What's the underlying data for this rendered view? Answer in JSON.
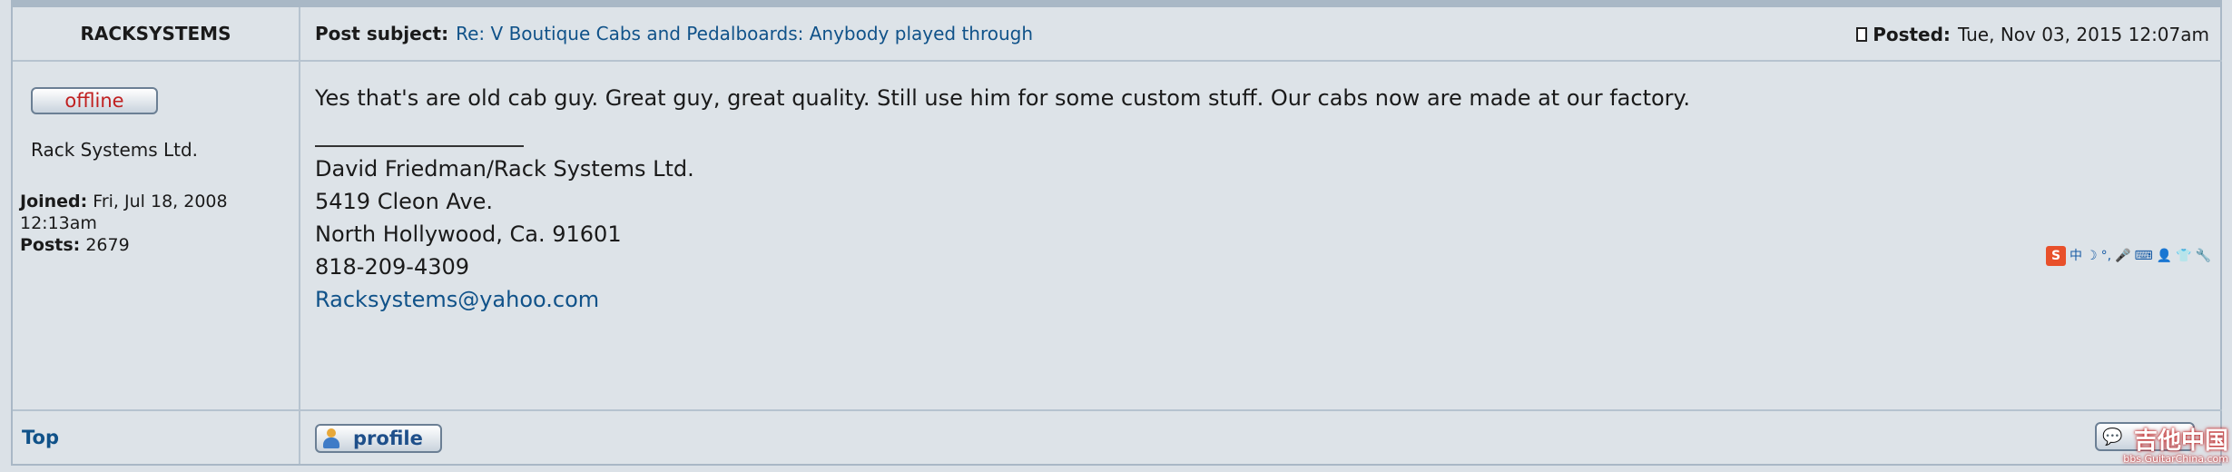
{
  "post": {
    "author": "RACKSYSTEMS",
    "subject_label": "Post subject:",
    "subject": "Re: V Boutique Cabs and Pedalboards: Anybody played through",
    "posted_label": "Posted:",
    "posted_value": "Tue, Nov 03, 2015 12:07am",
    "status_button": "offline",
    "rank": "Rack Systems Ltd.",
    "joined_label": "Joined:",
    "joined_value": "Fri, Jul 18, 2008 12:13am",
    "posts_label": "Posts:",
    "posts_value": "2679",
    "message": "Yes that's are old cab guy. Great guy, great quality. Still use him for some custom stuff. Our cabs now are made at our factory.",
    "signature": {
      "rule": "________________",
      "line1": "David Friedman/Rack Systems Ltd.",
      "line2": "5419 Cleon Ave.",
      "line3": "North Hollywood, Ca. 91601",
      "line4": "818-209-4309",
      "email": "Racksystems@yahoo.com"
    },
    "top_link": "Top",
    "profile_button": "profile"
  },
  "ime_bar": {
    "logo": "S",
    "glyphs": [
      "中",
      "☽",
      "°,",
      "🎤",
      "⌨",
      "👤",
      "👕",
      "🔧"
    ]
  },
  "watermark": {
    "title": "吉他中国",
    "url": "bbs.GuitarChina.com"
  },
  "colors": {
    "link": "#105289",
    "offline": "#c02020",
    "border": "#a9b8c6",
    "background": "#dde3e8"
  },
  "icons": {
    "posted": "document-icon",
    "profile": "user-icon",
    "quote": "quote-icon"
  }
}
